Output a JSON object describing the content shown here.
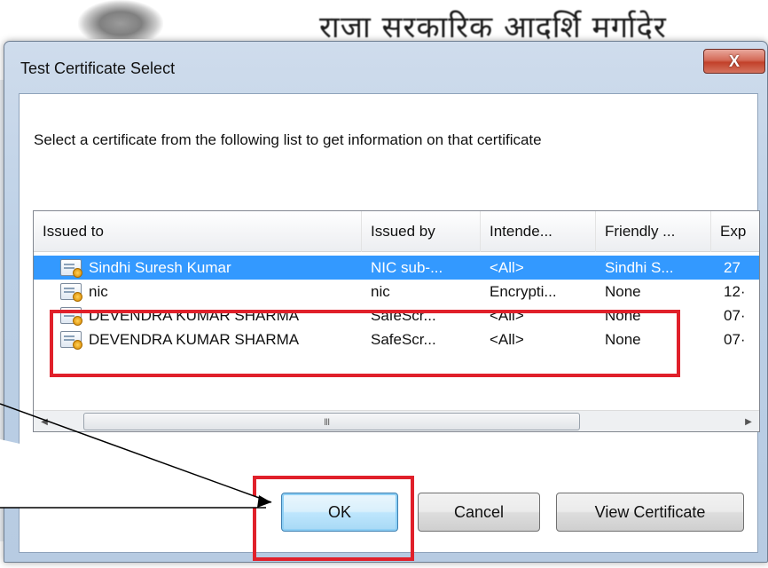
{
  "background": {
    "hindi_text": "राजा सरकारिक आदर्शि मर्गादेर"
  },
  "window": {
    "title": "Test Certificate Select",
    "close_label": "X",
    "instruction": "Select a certificate from the following list to get information on that certificate"
  },
  "list": {
    "columns": [
      "Issued to",
      "Issued by",
      "Intende...",
      "Friendly ...",
      "Exp"
    ],
    "rows": [
      {
        "issued_to": "Sindhi Suresh Kumar",
        "issued_by": "NIC sub-...",
        "intended": "<All>",
        "friendly": "Sindhi S...",
        "exp": "27"
      },
      {
        "issued_to": "nic",
        "issued_by": "nic",
        "intended": "Encrypti...",
        "friendly": "None",
        "exp": "12·"
      },
      {
        "issued_to": "DEVENDRA KUMAR SHARMA",
        "issued_by": "SafeScr...",
        "intended": "<All>",
        "friendly": "None",
        "exp": "07·"
      },
      {
        "issued_to": "DEVENDRA KUMAR SHARMA",
        "issued_by": "SafeScr...",
        "intended": "<All>",
        "friendly": "None",
        "exp": "07·"
      }
    ],
    "selected_row": 0,
    "scroll_grip": "III"
  },
  "buttons": {
    "ok": "OK",
    "cancel": "Cancel",
    "view_certificate": "View Certificate"
  },
  "colors": {
    "selection": "#3399ff",
    "annotation_red": "#e0202a"
  }
}
